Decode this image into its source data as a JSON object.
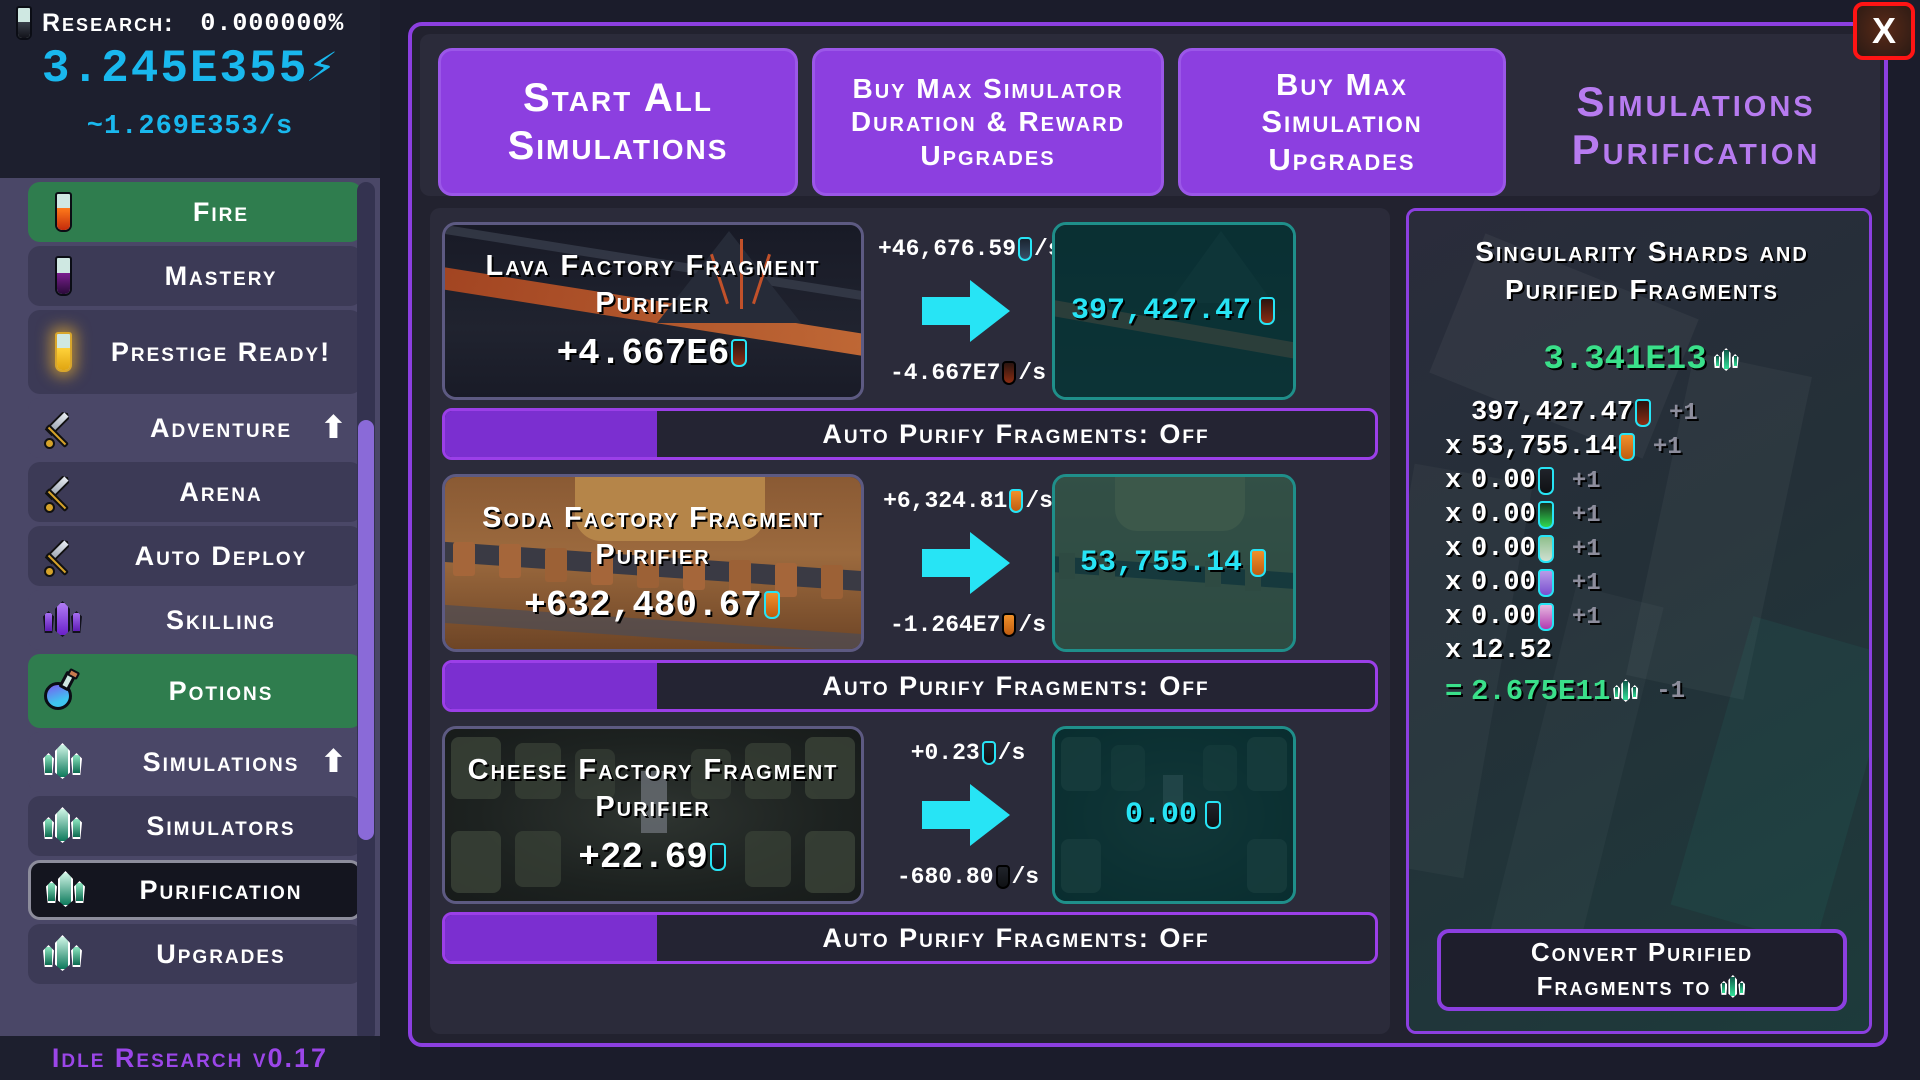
{
  "header": {
    "research_label": "Research:",
    "research_pct": "0.000000%",
    "energy_total": "3.245E355",
    "energy_rate": "~1.269E353/s",
    "version": "Idle Research v0.17"
  },
  "sidebar": {
    "items": [
      {
        "label": "Fire",
        "icon": "test-tube-fire-icon",
        "state": "active"
      },
      {
        "label": "Mastery",
        "icon": "test-tube-mastery-icon",
        "state": "normal"
      },
      {
        "label": "Prestige Ready!",
        "icon": "test-tube-prestige-icon",
        "state": "normal"
      },
      {
        "label": "Adventure",
        "icon": "sword-icon",
        "state": "alt",
        "arrow": "⬆"
      },
      {
        "label": "Arena",
        "icon": "sword-icon",
        "state": "normal"
      },
      {
        "label": "Auto Deploy",
        "icon": "sword-icon",
        "state": "normal"
      },
      {
        "label": "Skilling",
        "icon": "crystal-purple-icon",
        "state": "alt"
      },
      {
        "label": "Potions",
        "icon": "potion-flask-icon",
        "state": "active"
      },
      {
        "label": "Simulations",
        "icon": "crystal-green-icon",
        "state": "alt",
        "arrow": "⬆"
      },
      {
        "label": "Simulators",
        "icon": "crystal-green-icon",
        "state": "normal"
      },
      {
        "label": "Purification",
        "icon": "crystal-green-icon",
        "state": "selected"
      },
      {
        "label": "Upgrades",
        "icon": "crystal-green-icon",
        "state": "normal"
      }
    ]
  },
  "modal": {
    "title_line1": "Simulations",
    "title_line2": "Purification",
    "close_label": "X",
    "buttons": {
      "start_all": "Start All Simulations",
      "buy_max_duration": "Buy Max Simulator Duration & Reward Upgrades",
      "buy_max_upgrades": "Buy Max Simulation Upgrades"
    }
  },
  "purifiers": [
    {
      "name": "Lava Factory Fragment Purifier",
      "value": "+4.667E6",
      "rate_in": "+46,676.59",
      "rate_in_suffix": "/s",
      "rate_out": "-4.667E7",
      "rate_out_suffix": "/s",
      "output": "397,427.47",
      "auto_label": "Auto Purify Fragments: Off",
      "theme": "lava"
    },
    {
      "name": "Soda Factory Fragment Purifier",
      "value": "+632,480.67",
      "rate_in": "+6,324.81",
      "rate_in_suffix": "/s",
      "rate_out": "-1.264E7",
      "rate_out_suffix": "/s",
      "output": "53,755.14",
      "auto_label": "Auto Purify Fragments: Off",
      "theme": "soda"
    },
    {
      "name": "Cheese Factory Fragment Purifier",
      "value": "+22.69",
      "rate_in": "+0.23",
      "rate_in_suffix": "/s",
      "rate_out": "-680.80",
      "rate_out_suffix": "/s",
      "output": "0.00",
      "auto_label": "Auto Purify Fragments: Off",
      "theme": "cheese"
    }
  ],
  "right_panel": {
    "title_line1": "Singularity Shards and",
    "title_line2": "Purified Fragments",
    "total": "3.341E13",
    "lines": [
      {
        "op": "",
        "num": "397,427.47",
        "glyph": "lava",
        "plus": "+1"
      },
      {
        "op": "x",
        "num": "53,755.14",
        "glyph": "soda",
        "plus": "+1"
      },
      {
        "op": "x",
        "num": "0.00",
        "glyph": "cheese",
        "plus": "+1"
      },
      {
        "op": "x",
        "num": "0.00",
        "glyph": "green",
        "plus": "+1"
      },
      {
        "op": "x",
        "num": "0.00",
        "glyph": "mint",
        "plus": "+1"
      },
      {
        "op": "x",
        "num": "0.00",
        "glyph": "violet",
        "plus": "+1"
      },
      {
        "op": "x",
        "num": "0.00",
        "glyph": "magenta",
        "plus": "+1"
      },
      {
        "op": "x",
        "num": "12.52",
        "glyph": "",
        "plus": ""
      },
      {
        "op": "=",
        "num": "2.675E11",
        "glyph": "shard",
        "plus": "-1",
        "final": true
      }
    ],
    "convert_line1": "Convert Purified",
    "convert_line2": "Fragments to"
  },
  "colors": {
    "accent_purple": "#8c3fe0",
    "cyan": "#27e4f5",
    "green": "#3ae08a",
    "energy_blue": "#19b8ee",
    "active_green": "#2f7d4e"
  }
}
